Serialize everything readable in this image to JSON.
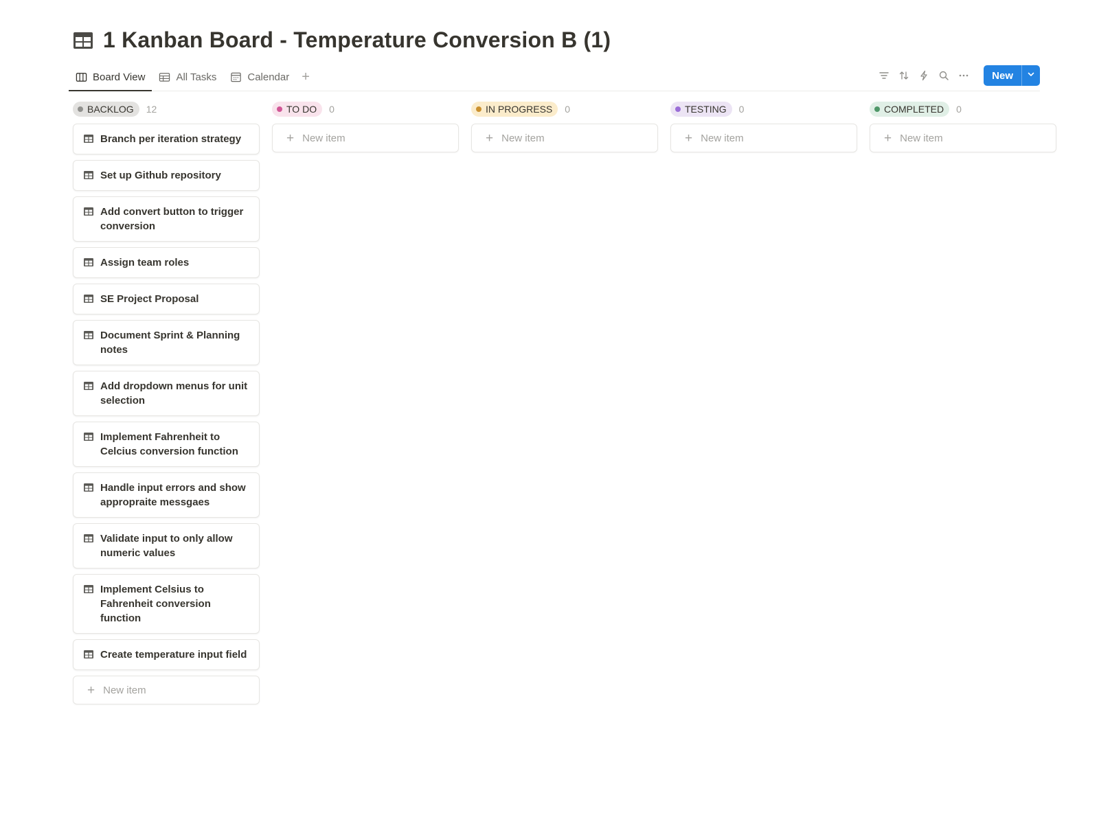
{
  "page": {
    "title": "1 Kanban Board - Temperature Conversion B (1)",
    "icon": "table-icon"
  },
  "tabs": [
    {
      "label": "Board View",
      "icon": "board-icon",
      "active": true
    },
    {
      "label": "All Tasks",
      "icon": "table-icon",
      "active": false
    },
    {
      "label": "Calendar",
      "icon": "calendar-icon",
      "active": false
    }
  ],
  "add_tab_glyph": "+",
  "toolbar": {
    "tools": [
      "filter-icon",
      "sort-icon",
      "automation-icon",
      "search-icon",
      "more-icon"
    ],
    "new_label": "New"
  },
  "new_item_label": "New item",
  "plus_glyph": "+",
  "columns": [
    {
      "name": "BACKLOG",
      "count": "12",
      "pill_color": "#e3e2e0",
      "dot_color": "#91918e",
      "cards": [
        "Branch per iteration strategy",
        "Set up Github repository",
        "Add convert button to trigger conversion",
        "Assign team roles",
        "SE Project Proposal",
        "Document Sprint & Planning notes",
        "Add dropdown menus for unit selection",
        "Implement Fahrenheit to Celcius conversion function",
        "Handle input errors and show appropraite messgaes",
        "Validate input to only allow numeric values",
        "Implement Celsius to Fahrenheit conversion function",
        "Create temperature input field"
      ]
    },
    {
      "name": "TO DO",
      "count": "0",
      "pill_color": "#f9e3ec",
      "dot_color": "#d15796",
      "cards": []
    },
    {
      "name": "IN PROGRESS",
      "count": "0",
      "pill_color": "#fbeccb",
      "dot_color": "#cb912f",
      "cards": []
    },
    {
      "name": "TESTING",
      "count": "0",
      "pill_color": "#ece4f4",
      "dot_color": "#9a6dd7",
      "cards": []
    },
    {
      "name": "COMPLETED",
      "count": "0",
      "pill_color": "#e0efe6",
      "dot_color": "#4f9768",
      "cards": []
    }
  ]
}
